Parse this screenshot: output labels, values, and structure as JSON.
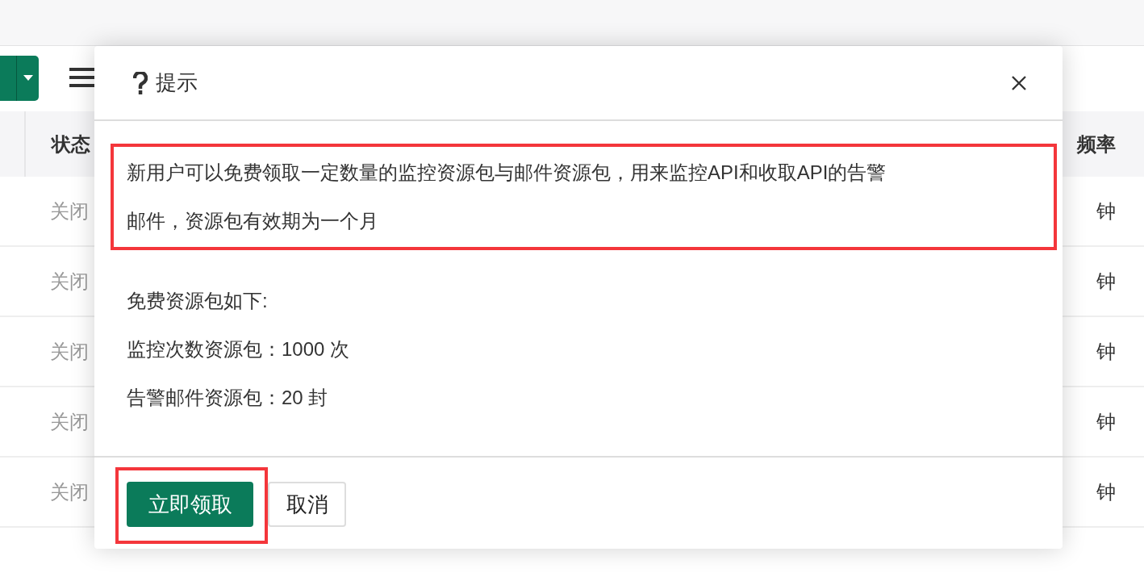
{
  "table": {
    "columns": [
      {
        "label": "状态"
      },
      {
        "label": "频率"
      }
    ],
    "rows": [
      {
        "cells": [
          "关闭",
          "钟"
        ]
      },
      {
        "cells": [
          "关闭",
          "钟"
        ]
      },
      {
        "cells": [
          "关闭",
          "钟"
        ]
      },
      {
        "cells": [
          "关闭",
          "钟"
        ]
      },
      {
        "cells": [
          "关闭",
          "钟"
        ]
      }
    ]
  },
  "dialog": {
    "title": "提示",
    "paragraphs": [
      {
        "text": "新用户可以免费领取一定数量的监控资源包与邮件资源包，用来监控API和收取API的告警邮件，资源包有效期为一个月",
        "highlighted": true
      },
      {
        "text": "免费资源包如下:",
        "highlighted": false
      },
      {
        "text": "监控次数资源包：1000 次",
        "highlighted": false
      },
      {
        "text": "告警邮件资源包：20 封",
        "highlighted": false
      }
    ],
    "buttons": [
      {
        "label": "立即领取",
        "kind": "primary",
        "highlighted": true
      },
      {
        "label": "取消",
        "kind": "default",
        "highlighted": false
      }
    ]
  }
}
